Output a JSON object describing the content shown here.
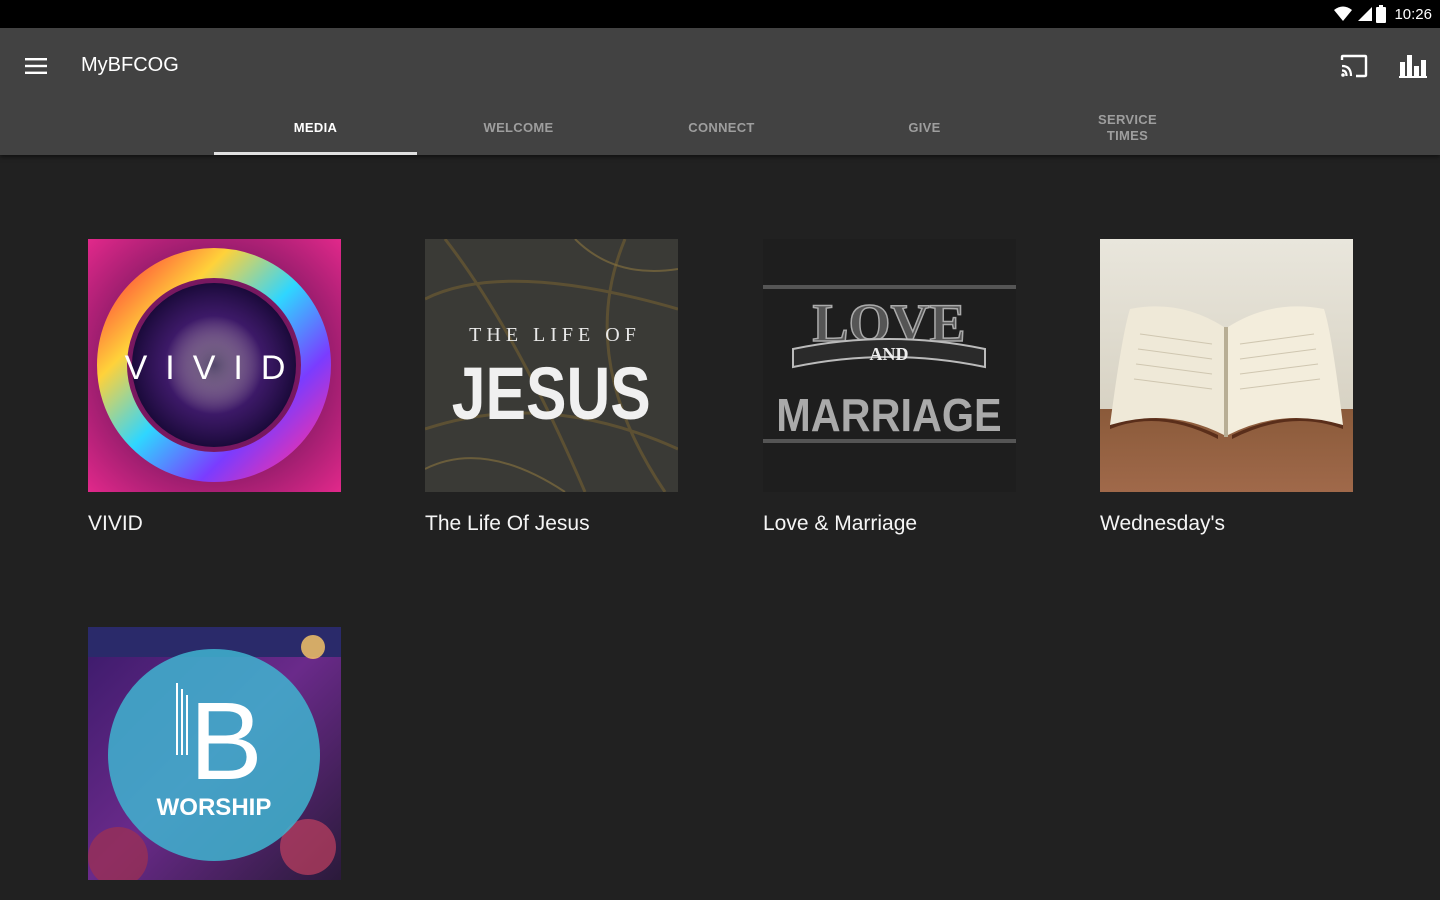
{
  "status_bar": {
    "time": "10:26"
  },
  "app_bar": {
    "title": "MyBFCOG",
    "menu_icon": "hamburger-menu-icon",
    "cast_icon": "cast-icon",
    "chart_icon": "bar-chart-icon"
  },
  "tabs": [
    {
      "label": "MEDIA",
      "active": true
    },
    {
      "label": "WELCOME",
      "active": false
    },
    {
      "label": "CONNECT",
      "active": false
    },
    {
      "label": "GIVE",
      "active": false
    },
    {
      "label": "SERVICE\nTIMES",
      "active": false
    }
  ],
  "media_items": [
    {
      "title": "VIVID",
      "art_text": "VIVID"
    },
    {
      "title": "The Life Of Jesus",
      "art_text_top": "THE LIFE OF",
      "art_text_main": "JESUS"
    },
    {
      "title": "Love & Marriage",
      "art_text_top": "LOVE",
      "art_text_mid": "AND",
      "art_text_main": "MARRIAGE"
    },
    {
      "title": "Wednesday's"
    },
    {
      "title": "",
      "art_text_letter": "B",
      "art_text_main": "WORSHIP"
    }
  ],
  "colors": {
    "status_bar": "#000000",
    "app_bar": "#424242",
    "background": "#212121",
    "tab_indicator": "#e0e0e0",
    "tab_inactive": "#9e9e9e"
  }
}
